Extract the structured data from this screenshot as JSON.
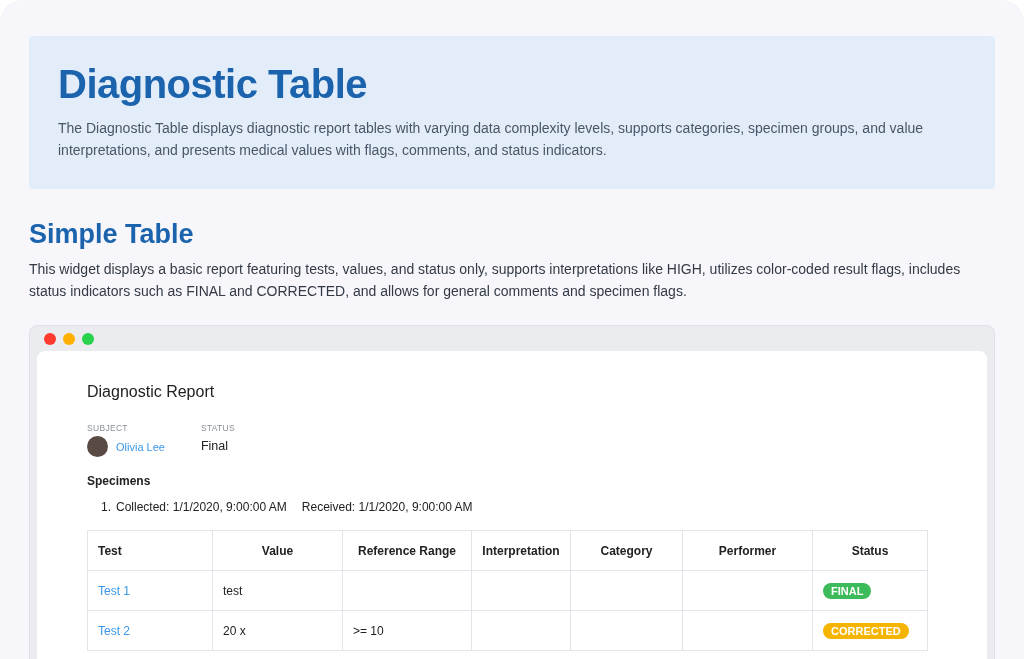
{
  "hero": {
    "title": "Diagnostic Table",
    "description": "The Diagnostic Table displays diagnostic report tables with varying data complexity levels, supports categories, specimen groups, and value interpretations, and presents medical values with flags, comments, and status indicators."
  },
  "section": {
    "title": "Simple Table",
    "description": "This widget displays a basic report featuring tests, values, and status only, supports interpretations like HIGH, utilizes color-coded result flags, includes status indicators such as FINAL and CORRECTED, and allows for general comments and specimen flags."
  },
  "report": {
    "title": "Diagnostic Report",
    "subject_label": "SUBJECT",
    "subject": "Olivia Lee",
    "status_label": "STATUS",
    "status": "Final",
    "specimens_title": "Specimens",
    "specimens": [
      {
        "number": "1.",
        "collected": "Collected: 1/1/2020, 9:00:00 AM",
        "received": "Received: 1/1/2020, 9:00:00 AM"
      }
    ]
  },
  "table": {
    "columns": [
      "Test",
      "Value",
      "Reference Range",
      "Interpretation",
      "Category",
      "Performer",
      "Status"
    ],
    "rows": [
      {
        "test": "Test 1",
        "value": "test",
        "reference_range": "",
        "status": "FINAL",
        "color": "#3dbb5a"
      },
      {
        "test": "Test 2",
        "value": "20 x",
        "reference_range": ">= 10",
        "status": "CORRECTED",
        "color": "#f5b400"
      }
    ]
  }
}
